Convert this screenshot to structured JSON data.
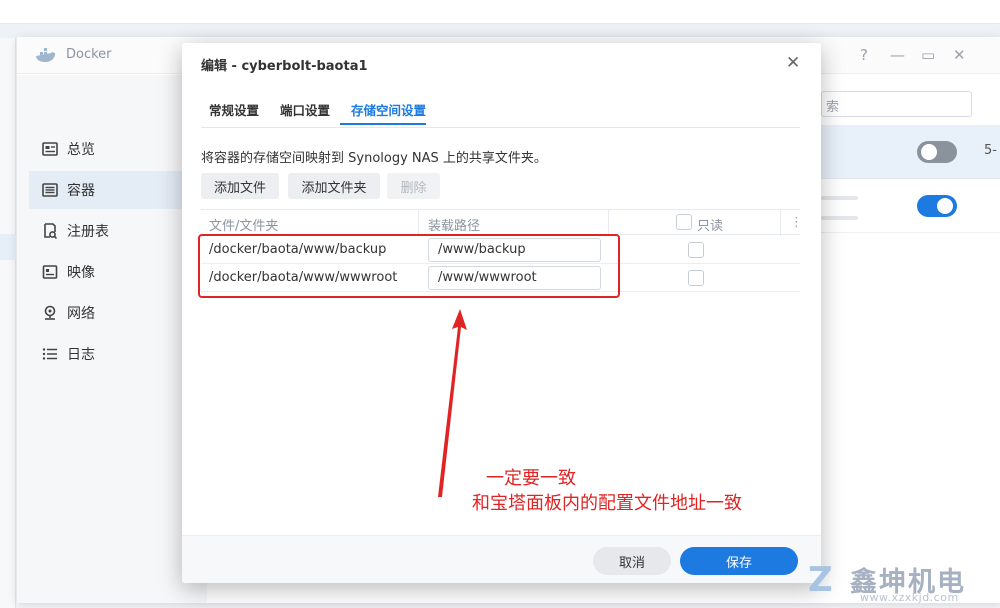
{
  "window": {
    "title": "Docker",
    "controls": [
      "?",
      "—",
      "▭",
      "✕"
    ]
  },
  "sidebar": {
    "items": [
      {
        "label": "总览",
        "icon": "overview-icon"
      },
      {
        "label": "容器",
        "icon": "container-icon"
      },
      {
        "label": "注册表",
        "icon": "registry-icon"
      },
      {
        "label": "映像",
        "icon": "image-icon"
      },
      {
        "label": "网络",
        "icon": "network-icon"
      },
      {
        "label": "日志",
        "icon": "log-icon"
      }
    ],
    "active_index": 1
  },
  "right_panel": {
    "search_fragment": "索",
    "row1_edge_text": "5-"
  },
  "dialog": {
    "title": "编辑 - cyberbolt-baota1",
    "close_label": "✕",
    "tabs": [
      "常规设置",
      "端口设置",
      "存储空间设置"
    ],
    "active_tab": "存储空间设置",
    "description": "将容器的存储空间映射到 Synology NAS 上的共享文件夹。",
    "buttons": {
      "add_file": "添加文件",
      "add_folder": "添加文件夹",
      "delete": "删除"
    },
    "columns": {
      "file_folder": "文件/文件夹",
      "mount_path": "装载路径",
      "read_only": "只读"
    },
    "rows": [
      {
        "source": "/docker/baota/www/backup",
        "mount": "/www/backup"
      },
      {
        "source": "/docker/baota/www/wwwroot",
        "mount": "/www/wwwroot"
      }
    ],
    "footer": {
      "cancel": "取消",
      "save": "保存"
    }
  },
  "annotation": {
    "line1": "一定要一致",
    "line2": "和宝塔面板内的配置文件地址一致",
    "color": "#e02424"
  },
  "watermark": {
    "logo": "Z",
    "text": "鑫坤机电",
    "url": "www.xzxkjd.com"
  },
  "colors": {
    "accent": "#1d7ae0",
    "annotation": "#e02424"
  }
}
